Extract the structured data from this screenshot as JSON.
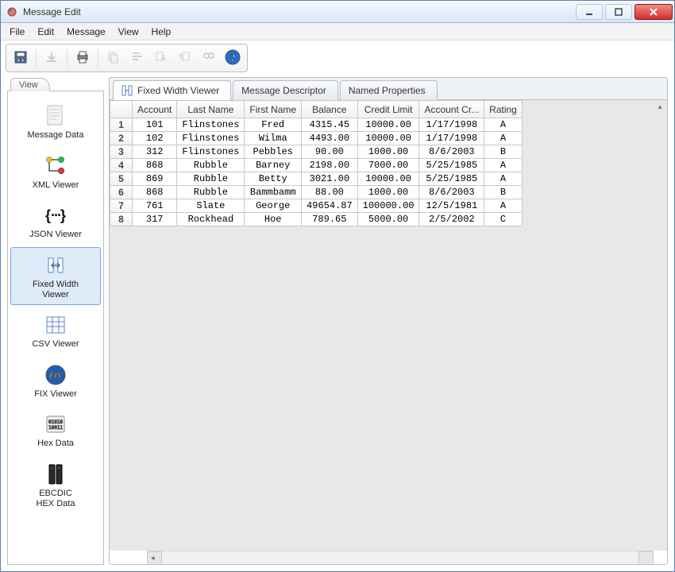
{
  "window": {
    "title": "Message Edit"
  },
  "menu": {
    "items": [
      "File",
      "Edit",
      "Message",
      "View",
      "Help"
    ]
  },
  "toolbar": {
    "buttons": [
      {
        "name": "save-icon",
        "enabled": true
      },
      {
        "name": "download-icon",
        "enabled": false
      },
      {
        "name": "print-icon",
        "enabled": true
      },
      {
        "name": "copy-icon",
        "enabled": false
      },
      {
        "name": "align-icon",
        "enabled": false
      },
      {
        "name": "import-icon",
        "enabled": false
      },
      {
        "name": "export-icon",
        "enabled": false
      },
      {
        "name": "find-icon",
        "enabled": false
      },
      {
        "name": "help-icon",
        "enabled": true
      }
    ]
  },
  "sidebar": {
    "tab_label": "View",
    "items": [
      {
        "label": "Message Data",
        "icon": "document-icon",
        "selected": false
      },
      {
        "label": "XML Viewer",
        "icon": "xml-tree-icon",
        "selected": false
      },
      {
        "label": "JSON Viewer",
        "icon": "json-icon",
        "selected": false
      },
      {
        "label": "Fixed Width\nViewer",
        "icon": "columns-icon",
        "selected": true
      },
      {
        "label": "CSV Viewer",
        "icon": "grid-icon",
        "selected": false
      },
      {
        "label": "FIX Viewer",
        "icon": "fix-icon",
        "selected": false
      },
      {
        "label": "Hex Data",
        "icon": "binary-icon",
        "selected": false
      },
      {
        "label": "EBCDIC\nHEX Data",
        "icon": "server-icon",
        "selected": false
      }
    ]
  },
  "tabs": {
    "items": [
      {
        "label": "Fixed Width Viewer",
        "icon": "columns-icon",
        "active": true
      },
      {
        "label": "Message Descriptor",
        "icon": "",
        "active": false
      },
      {
        "label": "Named Properties",
        "icon": "",
        "active": false
      }
    ]
  },
  "grid": {
    "columns": [
      "Account",
      "Last Name",
      "First Name",
      "Balance",
      "Credit Limit",
      "Account Cr...",
      "Rating"
    ],
    "rows": [
      [
        "101",
        "Flinstones",
        "Fred",
        "4315.45",
        "10000.00",
        "1/17/1998",
        "A"
      ],
      [
        "102",
        "Flinstones",
        "Wilma",
        "4493.00",
        "10000.00",
        "1/17/1998",
        "A"
      ],
      [
        "312",
        "Flinstones",
        "Pebbles",
        "90.00",
        "1000.00",
        "8/6/2003",
        "B"
      ],
      [
        "868",
        "Rubble",
        "Barney",
        "2198.00",
        "7000.00",
        "5/25/1985",
        "A"
      ],
      [
        "869",
        "Rubble",
        "Betty",
        "3021.00",
        "10000.00",
        "5/25/1985",
        "A"
      ],
      [
        "868",
        "Rubble",
        "Bammbamm",
        "88.00",
        "1000.00",
        "8/6/2003",
        "B"
      ],
      [
        "761",
        "Slate",
        "George",
        "49654.87",
        "100000.00",
        "12/5/1981",
        "A"
      ],
      [
        "317",
        "Rockhead",
        "Hoe",
        "789.65",
        "5000.00",
        "2/5/2002",
        "C"
      ]
    ]
  }
}
